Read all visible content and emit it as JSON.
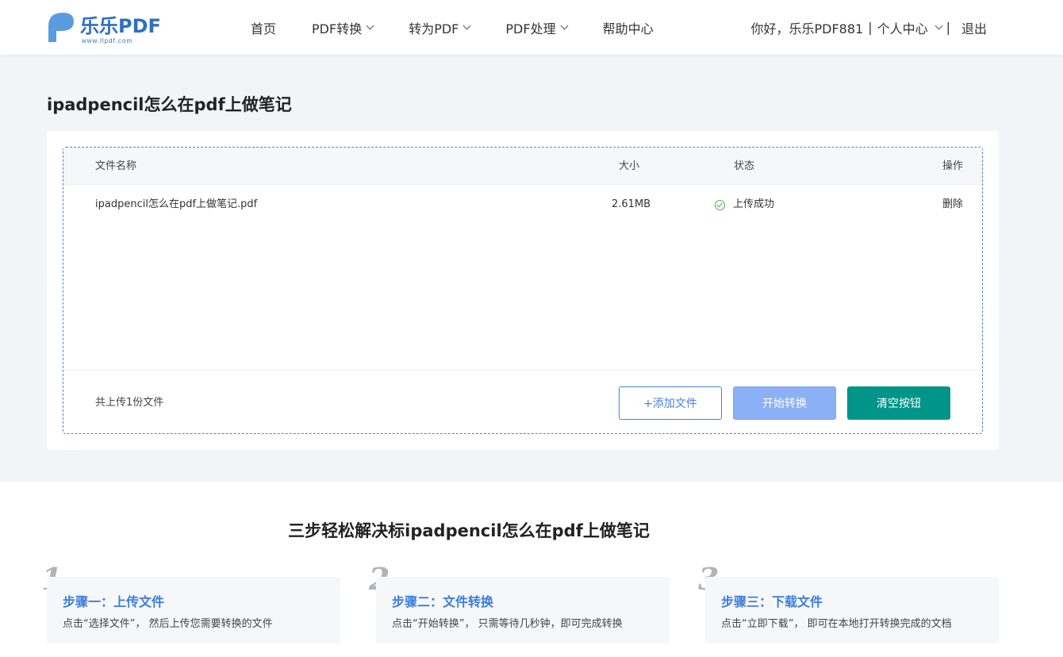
{
  "header": {
    "logo_text": "乐乐PDF",
    "logo_url_text": "www.llpdf.com",
    "nav": [
      {
        "label": "首页",
        "has_dropdown": false
      },
      {
        "label": "PDF转换",
        "has_dropdown": true
      },
      {
        "label": "转为PDF",
        "has_dropdown": true
      },
      {
        "label": "PDF处理",
        "has_dropdown": true
      },
      {
        "label": "帮助中心",
        "has_dropdown": false
      }
    ],
    "greeting": "你好，乐乐PDF881",
    "user_center": "个人中心",
    "logout": "退出"
  },
  "main": {
    "page_title": "ipadpencil怎么在pdf上做笔记",
    "table": {
      "headers": {
        "name": "文件名称",
        "size": "大小",
        "status": "状态",
        "op": "操作"
      },
      "rows": [
        {
          "name": "ipadpencil怎么在pdf上做笔记.pdf",
          "size": "2.61MB",
          "status": "上传成功",
          "op": "删除"
        }
      ]
    },
    "upload_count": "共上传1份文件",
    "buttons": {
      "add": "+添加文件",
      "start": "开始转换",
      "clear": "清空按钮"
    }
  },
  "steps": {
    "title": "三步轻松解决标ipadpencil怎么在pdf上做笔记",
    "items": [
      {
        "num": "1",
        "title": "步骤一：上传文件",
        "desc": "点击“选择文件”， 然后上传您需要转换的文件"
      },
      {
        "num": "2",
        "title": "步骤二：文件转换",
        "desc": "点击“开始转换”， 只需等待几秒钟，即可完成转换"
      },
      {
        "num": "3",
        "title": "步骤三：下载文件",
        "desc": "点击“立即下载”， 即可在本地打开转换完成的文档"
      }
    ]
  },
  "colors": {
    "accent": "#3c7ddc",
    "clear_button": "#009588",
    "start_button": "#8cb0f5",
    "success": "#4caf50"
  }
}
